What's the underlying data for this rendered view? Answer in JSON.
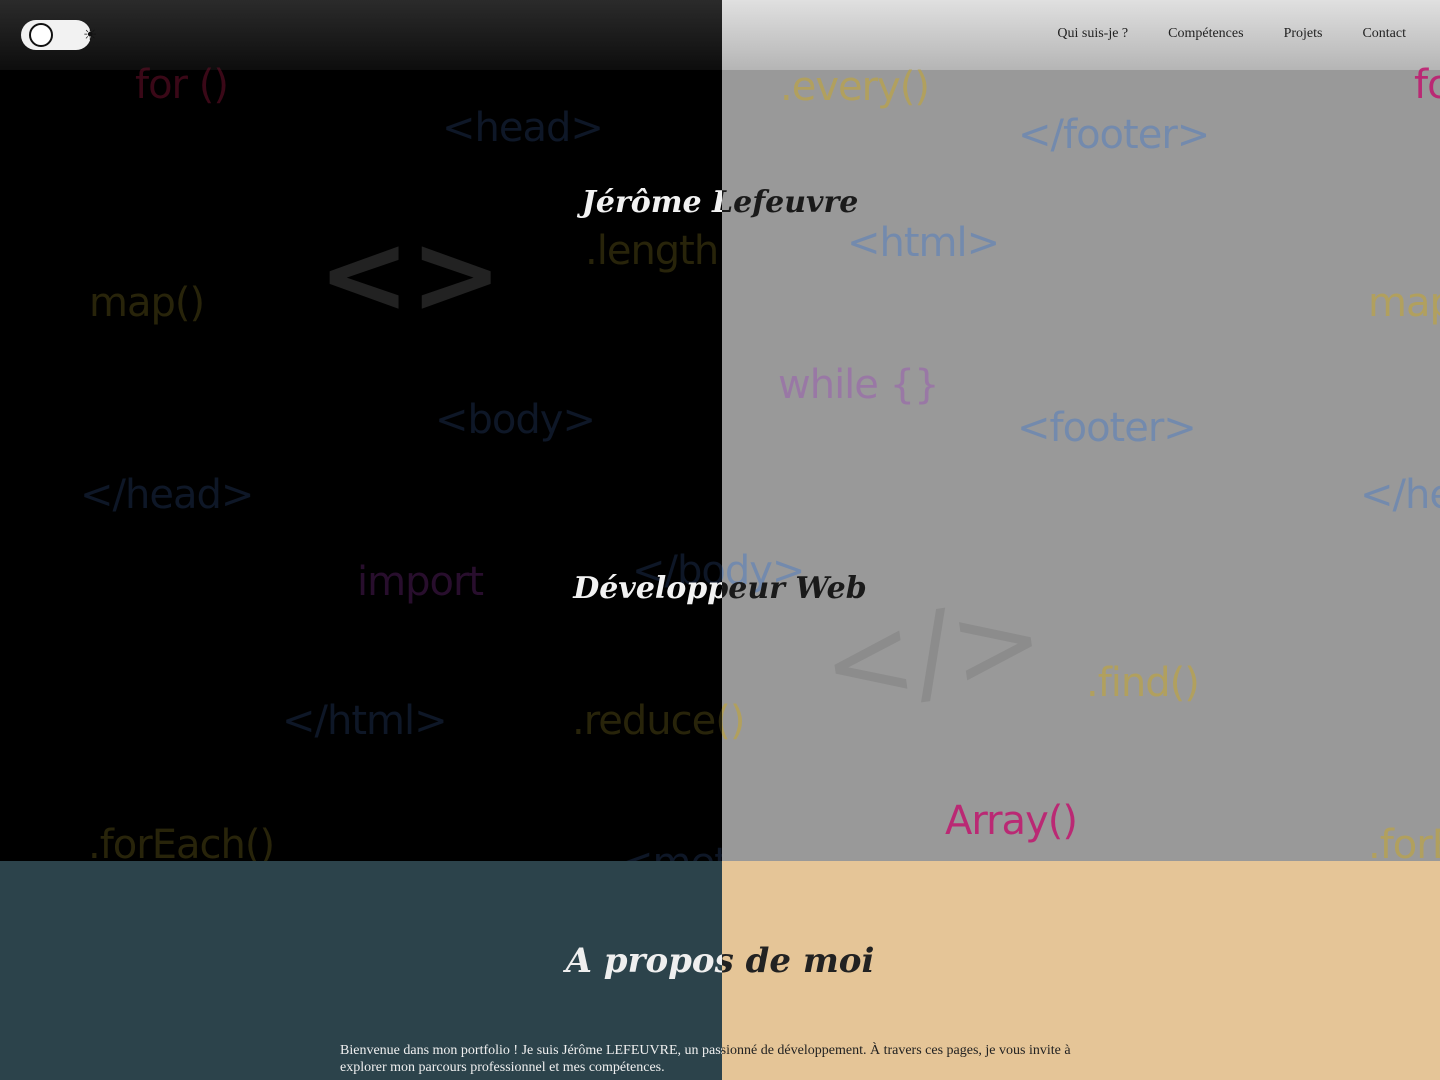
{
  "theme_toggle": {
    "icon": "sun-icon",
    "glyph": "☀"
  },
  "nav": {
    "items": [
      {
        "label": "Qui suis-je ?"
      },
      {
        "label": "Compétences"
      },
      {
        "label": "Projets"
      },
      {
        "label": "Contact"
      }
    ]
  },
  "hero": {
    "name": "Jérôme Lefeuvre",
    "role": "Développeur Web",
    "background_keywords": {
      "for": "for ()",
      "every": ".every()",
      "head_open": "<head>",
      "footer_close": "</footer>",
      "length": ".length",
      "html_open": "<html>",
      "map": "map()",
      "while": "while {}",
      "body_open": "<body>",
      "footer_open": "<footer>",
      "head_close": "</head>",
      "body_close": "</body>",
      "import": "import",
      "html_close": "</html>",
      "reduce": ".reduce()",
      "find": ".find()",
      "array": "Array()",
      "foreach": ".forEach()",
      "meta": "<meta>",
      "brackets": "<>",
      "slash_brackets": "</>"
    }
  },
  "about": {
    "title": "A propos de moi",
    "text": "Bienvenue dans mon portfolio ! Je suis Jérôme LEFEUVRE, un passionné de développement. À travers ces pages, je vous invite à explorer mon parcours professionnel et mes compétences."
  },
  "colors": {
    "dark_about_bg": "#2c434b",
    "light_about_bg": "#e5c597",
    "light_hero_bg": "#999999"
  }
}
